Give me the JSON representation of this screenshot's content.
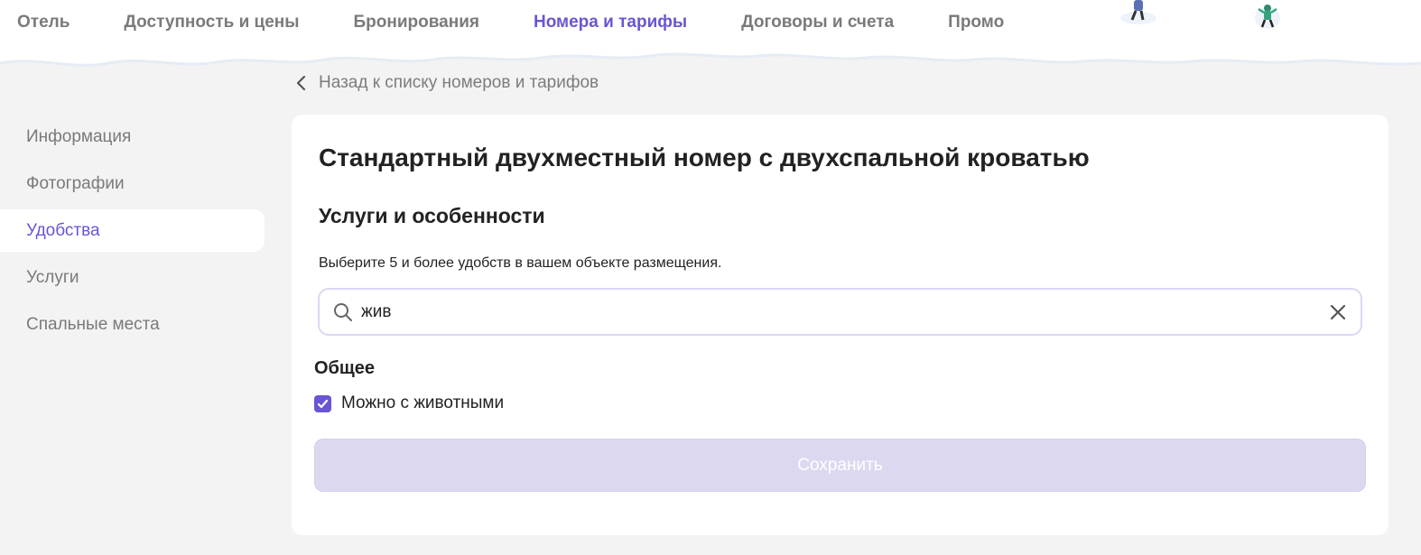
{
  "nav": {
    "items": [
      {
        "label": "Отель",
        "active": false
      },
      {
        "label": "Доступность и цены",
        "active": false
      },
      {
        "label": "Бронирования",
        "active": false
      },
      {
        "label": "Номера и тарифы",
        "active": true
      },
      {
        "label": "Договоры и счета",
        "active": false
      },
      {
        "label": "Промо",
        "active": false
      }
    ]
  },
  "back_link": {
    "label": "Назад к списку номеров и тарифов",
    "icon": "chevron-left-icon"
  },
  "sidebar": {
    "items": [
      {
        "label": "Информация",
        "active": false
      },
      {
        "label": "Фотографии",
        "active": false
      },
      {
        "label": "Удобства",
        "active": true
      },
      {
        "label": "Услуги",
        "active": false
      },
      {
        "label": "Спальные места",
        "active": false
      }
    ]
  },
  "room": {
    "title": "Стандартный двухместный номер с двухспальной кроватью",
    "section_title": "Услуги и особенности",
    "hint": "Выберите 5 и более удобств в вашем объекте размещения."
  },
  "search": {
    "value": "жив",
    "icon": "search-icon",
    "clear_icon": "close-icon"
  },
  "amenities": {
    "group_title": "Общее",
    "items": [
      {
        "label": "Можно с животными",
        "checked": true
      }
    ]
  },
  "actions": {
    "save_label": "Сохранить",
    "save_disabled": true
  },
  "colors": {
    "accent": "#6a55d4",
    "text_muted": "#7a7a7a",
    "button_disabled": "#dcd8f0"
  }
}
